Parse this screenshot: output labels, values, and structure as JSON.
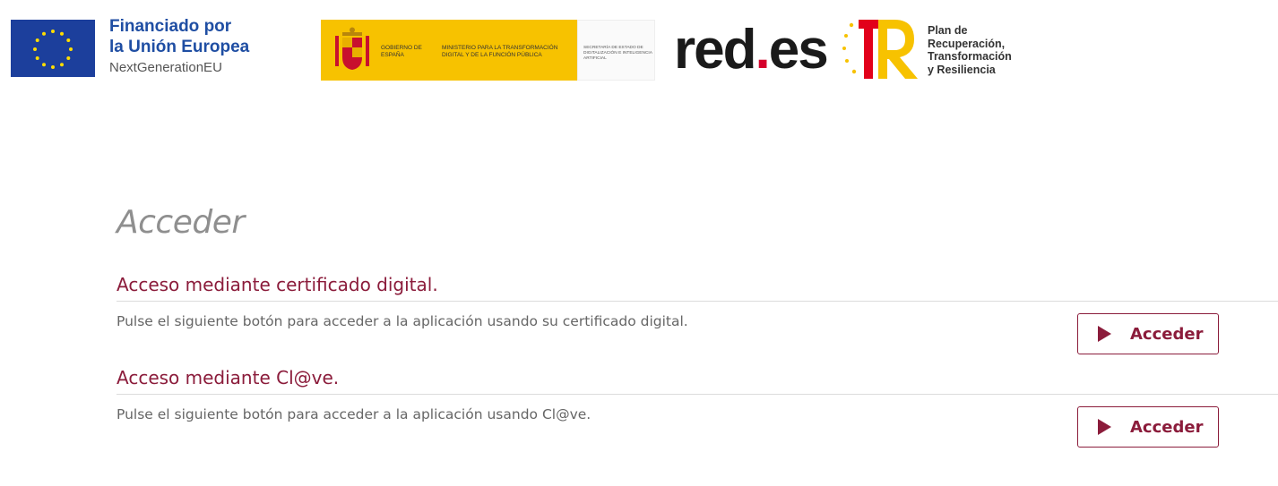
{
  "header": {
    "eu": {
      "line1": "Financiado por",
      "line2": "la Unión Europea",
      "line3": "NextGenerationEU",
      "flag_color": "#1c3f9c",
      "star_color": "#ffdd00"
    },
    "gobierno": {
      "name": "GOBIERNO DE ESPAÑA",
      "ministry": "MINISTERIO PARA LA TRANSFORMACIÓN DIGITAL Y DE LA FUNCIÓN PÚBLICA",
      "secretaria": "SECRETARÍA DE ESTADO DE DIGITALIZACIÓN E INTELIGENCIA ARTIFICIAL",
      "background_color": "#f7c200"
    },
    "redes": {
      "name": "red",
      "dot": ".",
      "suffix": "es",
      "accent_color": "#d5002b"
    },
    "prtr": {
      "line1": "Plan de",
      "line2": "Recuperación,",
      "line3": "Transformación",
      "line4": "y Resiliencia",
      "red_color": "#e2001a",
      "yellow_color": "#f7c200"
    }
  },
  "main": {
    "title": "Acceder",
    "sections": [
      {
        "title": "Acceso mediante certificado digital.",
        "description": "Pulse el siguiente botón para acceder a la aplicación usando su certificado digital.",
        "button_label": "Acceder",
        "button_icon": "play-icon"
      },
      {
        "title": "Acceso mediante Cl@ve.",
        "description": "Pulse el siguiente botón para acceder a la aplicación usando Cl@ve.",
        "button_label": "Acceder",
        "button_icon": "play-icon"
      }
    ]
  },
  "colors": {
    "accent": "#8b1c3b",
    "title_gray": "#8f8f8f",
    "text_gray": "#666666",
    "rule": "#dcdcdc"
  }
}
